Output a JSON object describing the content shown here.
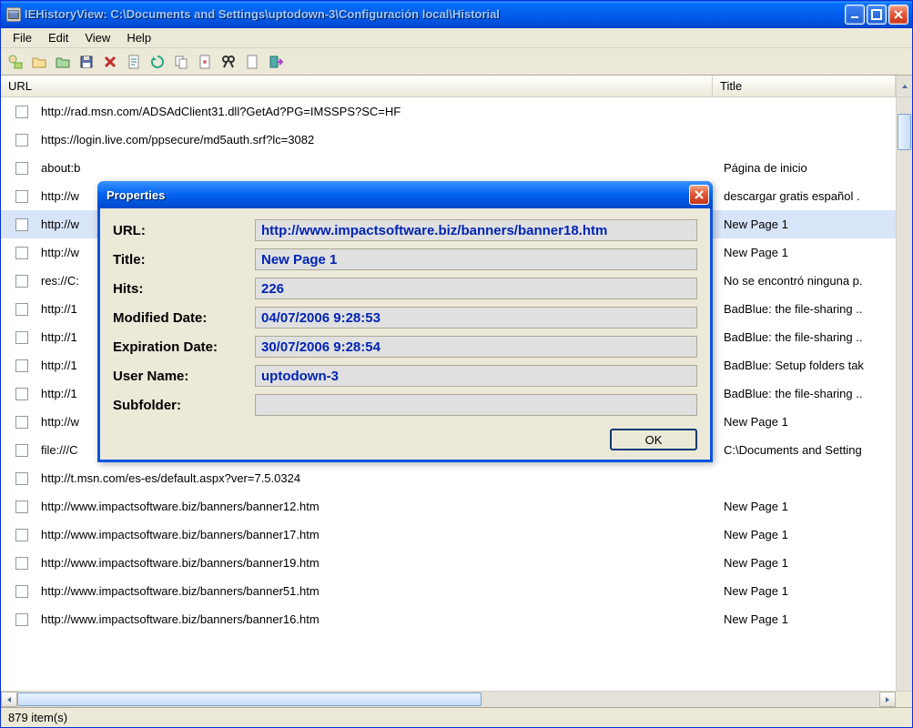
{
  "window": {
    "title": "IEHistoryView:  C:\\Documents and Settings\\uptodown-3\\Configuración local\\Historial"
  },
  "menu": {
    "file": "File",
    "edit": "Edit",
    "view": "View",
    "help": "Help"
  },
  "columns": {
    "url": "URL",
    "title": "Title"
  },
  "rows": [
    {
      "url": "http://rad.msn.com/ADSAdClient31.dll?GetAd?PG=IMSSPS?SC=HF",
      "title": ""
    },
    {
      "url": "https://login.live.com/ppsecure/md5auth.srf?lc=3082",
      "title": ""
    },
    {
      "url": "about:b",
      "title": "Página de inicio"
    },
    {
      "url": "http://w",
      "title": "descargar gratis español ."
    },
    {
      "url": "http://w",
      "title": "New Page 1"
    },
    {
      "url": "http://w",
      "title": "New Page 1"
    },
    {
      "url": "res://C:",
      "title": "No se encontró ninguna p."
    },
    {
      "url": "http://1",
      "title": "BadBlue: the file-sharing .."
    },
    {
      "url": "http://1",
      "title": "BadBlue: the file-sharing .."
    },
    {
      "url": "http://1",
      "title": "BadBlue: Setup folders tak"
    },
    {
      "url": "http://1",
      "title": "BadBlue: the file-sharing .."
    },
    {
      "url": "http://w",
      "title": "New Page 1"
    },
    {
      "url": "file:///C",
      "title": "C:\\Documents and Setting"
    },
    {
      "url": "http://t.msn.com/es-es/default.aspx?ver=7.5.0324",
      "title": ""
    },
    {
      "url": "http://www.impactsoftware.biz/banners/banner12.htm",
      "title": "New Page 1"
    },
    {
      "url": "http://www.impactsoftware.biz/banners/banner17.htm",
      "title": "New Page 1"
    },
    {
      "url": "http://www.impactsoftware.biz/banners/banner19.htm",
      "title": "New Page 1"
    },
    {
      "url": "http://www.impactsoftware.biz/banners/banner51.htm",
      "title": "New Page 1"
    },
    {
      "url": "http://www.impactsoftware.biz/banners/banner16.htm",
      "title": "New Page 1"
    }
  ],
  "selected_index": 4,
  "status": "879 item(s)",
  "dialog": {
    "title": "Properties",
    "labels": {
      "url": "URL:",
      "title": "Title:",
      "hits": "Hits:",
      "modified": "Modified Date:",
      "expiration": "Expiration Date:",
      "user": "User Name:",
      "subfolder": "Subfolder:"
    },
    "values": {
      "url": "http://www.impactsoftware.biz/banners/banner18.htm",
      "title": "New Page 1",
      "hits": "226",
      "modified": "04/07/2006 9:28:53",
      "expiration": "30/07/2006 9:28:54",
      "user": "uptodown-3",
      "subfolder": ""
    },
    "ok": "OK"
  }
}
